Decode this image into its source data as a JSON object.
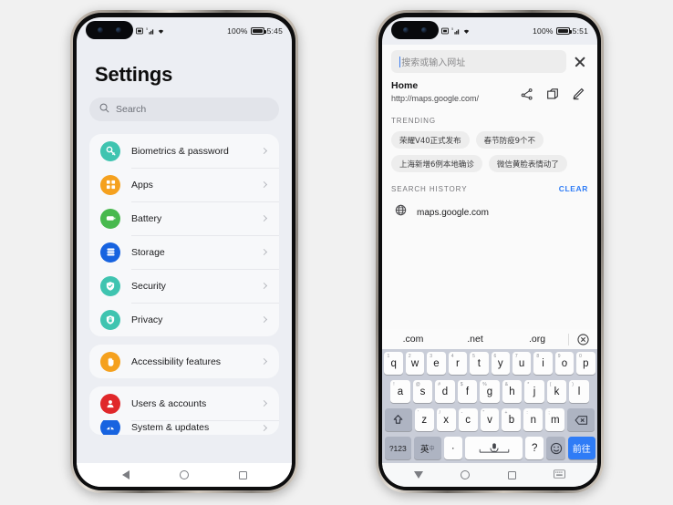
{
  "background_color": "#f1f1f1",
  "accent_color": "#2f7cf6",
  "phone_left": {
    "statusbar": {
      "icons": [
        "sim-card-icon",
        "signal-bars-icon",
        "wifi-icon"
      ],
      "battery_percent": "100%",
      "time": "5:45"
    },
    "settings": {
      "title": "Settings",
      "search": {
        "placeholder": "Search",
        "icon": "search-icon"
      },
      "groups": [
        {
          "items": [
            {
              "label": "Biometrics & password",
              "icon": "key-icon",
              "color": "#3fc4b0"
            },
            {
              "label": "Apps",
              "icon": "grid-icon",
              "color": "#f5a11e"
            },
            {
              "label": "Battery",
              "icon": "battery-icon",
              "color": "#48b94e"
            },
            {
              "label": "Storage",
              "icon": "storage-icon",
              "color": "#1763e0"
            },
            {
              "label": "Security",
              "icon": "shield-check-icon",
              "color": "#3fc4b0"
            },
            {
              "label": "Privacy",
              "icon": "lock-icon",
              "color": "#3fc4b0"
            }
          ]
        },
        {
          "items": [
            {
              "label": "Accessibility features",
              "icon": "hand-icon",
              "color": "#f5a11e"
            }
          ]
        },
        {
          "items": [
            {
              "label": "Users & accounts",
              "icon": "user-icon",
              "color": "#e0272a"
            },
            {
              "label": "System & updates",
              "icon": "system-icon",
              "color": "#1763e0"
            }
          ]
        }
      ]
    },
    "navbar": {
      "back": "back-triangle-icon",
      "home": "home-circle-icon",
      "recents": "recents-square-icon"
    }
  },
  "phone_right": {
    "statusbar": {
      "icons": [
        "sim-card-icon",
        "signal-bars-icon",
        "wifi-icon"
      ],
      "battery_percent": "100%",
      "time": "5:51"
    },
    "browser": {
      "urlbar": {
        "placeholder": "搜索或输入网址",
        "value": "",
        "close_icon": "close-icon"
      },
      "home": {
        "title": "Home",
        "url": "http://maps.google.com/",
        "actions": [
          "share-icon",
          "copy-icon",
          "edit-icon"
        ]
      },
      "trending": {
        "heading": "TRENDING",
        "chips": [
          "荣耀V40正式发布",
          "春节防疫9个不",
          "上海新增6例本地确诊",
          "微信黄脸表情动了"
        ]
      },
      "history": {
        "heading": "SEARCH HISTORY",
        "clear_label": "CLEAR",
        "items": [
          {
            "text": "maps.google.com",
            "icon": "globe-icon"
          }
        ]
      }
    },
    "keyboard": {
      "suggestions": [
        ".com",
        ".net",
        ".org"
      ],
      "close_icon": "keyboard-close-icon",
      "row1": [
        {
          "k": "q",
          "s": "1"
        },
        {
          "k": "w",
          "s": "2"
        },
        {
          "k": "e",
          "s": "3"
        },
        {
          "k": "r",
          "s": "4"
        },
        {
          "k": "t",
          "s": "5"
        },
        {
          "k": "y",
          "s": "6"
        },
        {
          "k": "u",
          "s": "7"
        },
        {
          "k": "i",
          "s": "8"
        },
        {
          "k": "o",
          "s": "9"
        },
        {
          "k": "p",
          "s": "0"
        }
      ],
      "row2": [
        {
          "k": "a",
          "s": "!"
        },
        {
          "k": "s",
          "s": "@"
        },
        {
          "k": "d",
          "s": "#"
        },
        {
          "k": "f",
          "s": "$"
        },
        {
          "k": "g",
          "s": "%"
        },
        {
          "k": "h",
          "s": "&"
        },
        {
          "k": "j",
          "s": "*"
        },
        {
          "k": "k",
          "s": "("
        },
        {
          "k": "l",
          "s": ")"
        }
      ],
      "row3": [
        {
          "k": "z",
          "s": "'"
        },
        {
          "k": "x",
          "s": "/"
        },
        {
          "k": "c",
          "s": "-"
        },
        {
          "k": "v",
          "s": "\""
        },
        {
          "k": "b",
          "s": "+"
        },
        {
          "k": "n",
          "s": ":"
        },
        {
          "k": "m",
          "s": ";"
        }
      ],
      "shift_icon": "shift-icon",
      "backspace_icon": "backspace-icon",
      "numeric_label": "?123",
      "lang_label": "英",
      "lang_sub": "中",
      "period_label": "·",
      "space_icon": "microphone-icon",
      "question_label": "?",
      "emoji_icon": "emoji-icon",
      "go_label": "前往"
    },
    "navbar": {
      "hide_keyboard": "down-triangle-icon",
      "home": "home-circle-icon",
      "recents": "recents-square-icon",
      "keyboard": "keyboard-icon"
    }
  }
}
